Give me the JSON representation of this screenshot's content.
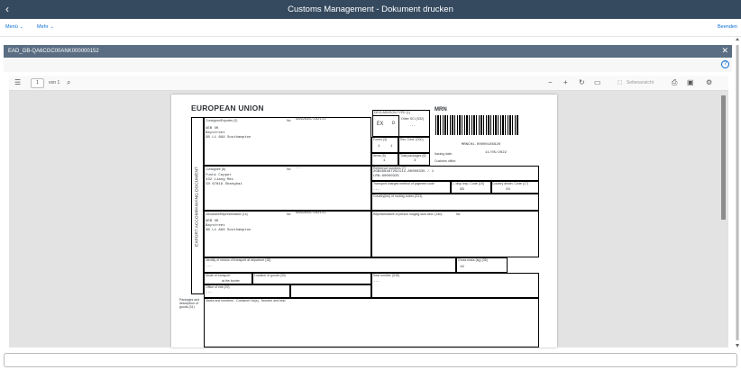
{
  "shell": {
    "title": "Customs Management - Dokument drucken"
  },
  "toolbar": {
    "menu": "Menü",
    "more": "Mehr",
    "end": "Beenden"
  },
  "panel": {
    "doc_id": "EAD_GB-QA6CGC00ANK000000152"
  },
  "viewer": {
    "page": "1",
    "of": "von 1",
    "page_view": "Seitenansicht"
  },
  "doc": {
    "header": "EUROPEAN UNION",
    "vertical": "EXPORT ACCOMPANYING DOCUMENT",
    "consignor_label": "Consignor/Exporter (2)",
    "no_label": "No",
    "consignor_no": "GB498487292111",
    "consignor_lines": "AEB UK\nBaystreet\nGB L1 8AX Southampton",
    "decl_type_label": "DECLARATION TYPE (1)",
    "decl_type_1": "EX",
    "decl_type_2": "D",
    "other_sci_label": "Other SCI (S32)",
    "other_sci": "---",
    "mrn_label": "MRN",
    "forms_label": "Forms (3)",
    "forms_1": "1",
    "forms_2": "1",
    "rec_decl_label": "Rec. Decl. (S00)",
    "mrn_value": "MRNCH1.00000185620",
    "items_label": "Items (5)",
    "items": "1",
    "packages_label": "Total packages (6)",
    "packages": "3",
    "issuing_label": "Issuing date:",
    "issuing_date": "11/05/2022",
    "customs_office_label": "Customs office:",
    "consignee_label": "Consignee (8)",
    "consignee_no": "---",
    "consignee_lines": "Fushi Copper\n432 Liang Mei\nCN 67819 Shanghai",
    "ref_label": "Reference numbers (7)",
    "ref_lines": "2GB498487292111-80000335 / 1\nLRN:80000335",
    "transport_charges_label": "Transport charges method of payment code",
    "transport_charges": "---",
    "c_disp_label": "C. disp./exp. Code (15)",
    "c_disp": "GB",
    "c_dest_label": "Country destin. Code (17)",
    "c_dest": "CN",
    "routing_label": "Country(ies) of routing codes (S13)",
    "declarant_label": "Declarant/Representative (14)",
    "declarant_no": "GB498487292111",
    "declarant_lines": "AEB UK\nBaystreet\nGB L1 8AX Southampton",
    "rep_label": "Representative of person lodging sum.decl. (14b)",
    "rep_no": "No",
    "identity_label": "Identity of means of transport at departure (18)",
    "identity": "---",
    "gross_label": "Gross mass (kg) (35)",
    "gross": "19",
    "mode_label": "Mode of transport",
    "border_label": "at the border",
    "loc_goods_label": "Location of goods (30)",
    "seal_label": "Seal number (S28)",
    "seal": "---",
    "exit_label": "Office of exit (29)",
    "exit": "---",
    "packages_desc_label": "Packages and description of goods (31)",
    "marks_label": "Marks and numbers - Container No(s) - Number and kind"
  }
}
